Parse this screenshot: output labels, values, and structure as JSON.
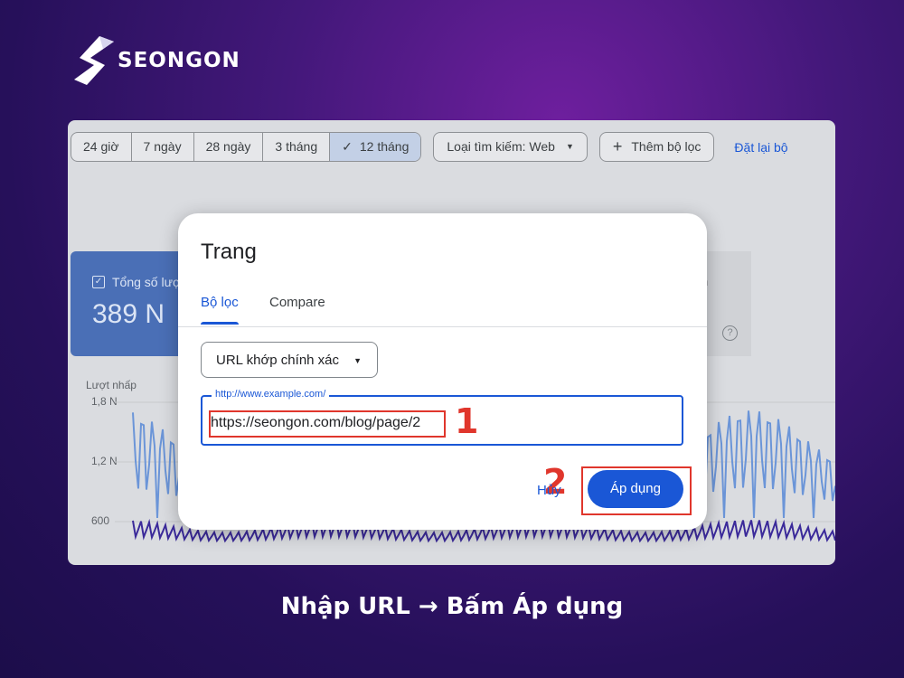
{
  "brand": {
    "name": "SEONGON"
  },
  "date_range": {
    "options": [
      "24 giờ",
      "7 ngày",
      "28 ngày",
      "3 tháng",
      "12 tháng"
    ],
    "selected": "12 tháng"
  },
  "search_type_chip": {
    "label": "Loại tìm kiếm: Web"
  },
  "add_filter_chip": {
    "label": "Thêm bộ lọc"
  },
  "reset_link": {
    "label": "Đặt lại bộ"
  },
  "metric_card": {
    "label": "Tổng số lượ",
    "value": "389 N"
  },
  "partial_card": {
    "label": "n"
  },
  "chart_data": {
    "type": "line",
    "ylabel": "Lượt nhấp",
    "y_ticks": [
      "1,8 N",
      "1,2 N",
      "600"
    ],
    "series": [
      {
        "color": "#6b95d8"
      },
      {
        "color": "#3b2a9a"
      }
    ]
  },
  "dialog": {
    "title": "Trang",
    "tabs": [
      "Bộ lọc",
      "Compare"
    ],
    "active_tab": "Bộ lọc",
    "match_type": "URL khớp chính xác",
    "url_placeholder": "http://www.example.com/",
    "url_value": "https://seongon.com/blog/page/2",
    "cancel_label": "Hủy",
    "apply_label": "Áp dụng"
  },
  "annotations": {
    "step1": "1",
    "step2": "2",
    "accent_color": "#e0362c"
  },
  "caption": "Nhập URL → Bấm Áp dụng"
}
